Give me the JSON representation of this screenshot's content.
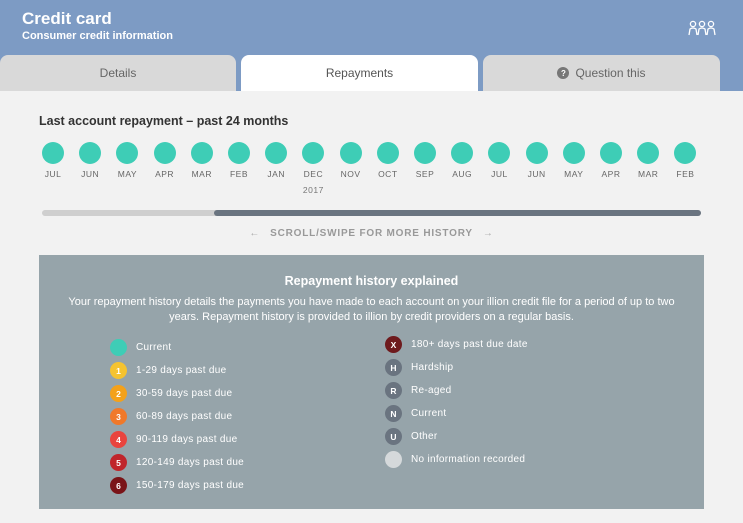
{
  "header": {
    "title": "Credit card",
    "subtitle": "Consumer credit information",
    "icon": "people-group-icon"
  },
  "tabs": [
    {
      "label": "Details",
      "active": false
    },
    {
      "label": "Repayments",
      "active": true
    },
    {
      "label": "Question this",
      "active": false,
      "icon": "question-icon",
      "icon_glyph": "?"
    }
  ],
  "repayments": {
    "title": "Last account repayment – past 24 months",
    "dot_color": "#3ecdb6",
    "months": [
      {
        "label": "JUL",
        "year": ""
      },
      {
        "label": "JUN",
        "year": ""
      },
      {
        "label": "MAY",
        "year": ""
      },
      {
        "label": "APR",
        "year": ""
      },
      {
        "label": "MAR",
        "year": ""
      },
      {
        "label": "FEB",
        "year": ""
      },
      {
        "label": "JAN",
        "year": ""
      },
      {
        "label": "DEC",
        "year": "2017"
      },
      {
        "label": "NOV",
        "year": ""
      },
      {
        "label": "OCT",
        "year": ""
      },
      {
        "label": "SEP",
        "year": ""
      },
      {
        "label": "AUG",
        "year": ""
      },
      {
        "label": "JUL",
        "year": ""
      },
      {
        "label": "JUN",
        "year": ""
      },
      {
        "label": "MAY",
        "year": ""
      },
      {
        "label": "APR",
        "year": ""
      },
      {
        "label": "MAR",
        "year": ""
      },
      {
        "label": "FEB",
        "year": ""
      }
    ],
    "scroll_hint": "SCROLL/SWIPE FOR MORE HISTORY",
    "scroll_left_arrow": "←",
    "scroll_right_arrow": "→"
  },
  "explained": {
    "title": "Repayment history explained",
    "text": "Your repayment history details the payments you have made to each account on your illion credit file for a period of up to two years. Repayment history is provided to illion by credit providers on a regular basis.",
    "legend_left": [
      {
        "badge": "",
        "label": "Current",
        "color": "#3ecdb6"
      },
      {
        "badge": "1",
        "label": "1-29 days past due",
        "color": "#f5c330"
      },
      {
        "badge": "2",
        "label": "30-59 days past due",
        "color": "#f3a11a"
      },
      {
        "badge": "3",
        "label": "60-89 days past due",
        "color": "#f0792a"
      },
      {
        "badge": "4",
        "label": "90-119 days past due",
        "color": "#e9443e"
      },
      {
        "badge": "5",
        "label": "120-149 days past due",
        "color": "#c0252b"
      },
      {
        "badge": "6",
        "label": "150-179 days past due",
        "color": "#7a1418"
      }
    ],
    "legend_right": [
      {
        "badge": "X",
        "label": "180+ days past due date",
        "color": "#6e1a1d"
      },
      {
        "badge": "H",
        "label": "Hardship",
        "color": "#6a7480"
      },
      {
        "badge": "R",
        "label": "Re-aged",
        "color": "#6a7480"
      },
      {
        "badge": "N",
        "label": "Current",
        "color": "#6a7480"
      },
      {
        "badge": "U",
        "label": "Other",
        "color": "#6a7480"
      },
      {
        "badge": "",
        "label": "No information recorded",
        "color": "#d5d9db"
      }
    ]
  }
}
